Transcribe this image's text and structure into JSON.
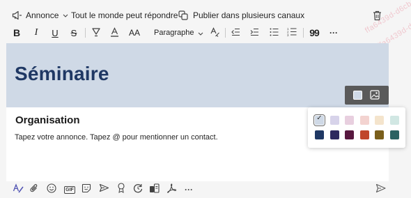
{
  "top_toolbar": {
    "post_type": "Annonce",
    "reply_permission": "Tout le monde peut répondre",
    "multi_channel": "Publier dans plusieurs canaux"
  },
  "format_toolbar": {
    "bold": "B",
    "italic": "I",
    "underline": "U",
    "strikethrough": "S",
    "font_size": "AA",
    "paragraph_style": "Paragraphe",
    "quote": "99",
    "more": "···"
  },
  "editor": {
    "banner_title": "Séminaire",
    "banner_color": "#cfd9e6",
    "subject": "Organisation",
    "body": "Tapez votre annonce. Tapez @ pour mentionner un contact."
  },
  "banner_palette": {
    "selected_index": 0,
    "check_mark": "✓",
    "row1": [
      "#cfd9e6",
      "#d7d3ea",
      "#e8cfdf",
      "#f3d3d0",
      "#f4e4cc",
      "#d1e7e3"
    ],
    "row2": [
      "#1f3864",
      "#2e2a5e",
      "#58183f",
      "#c0462a",
      "#7a5f1b",
      "#2b6262"
    ]
  },
  "bottom_toolbar": {
    "gif_label": "GIF",
    "more": "···"
  },
  "watermark": [
    "ffa6439d-d6cb-4761",
    "ffa6439d-d6cb-476"
  ]
}
